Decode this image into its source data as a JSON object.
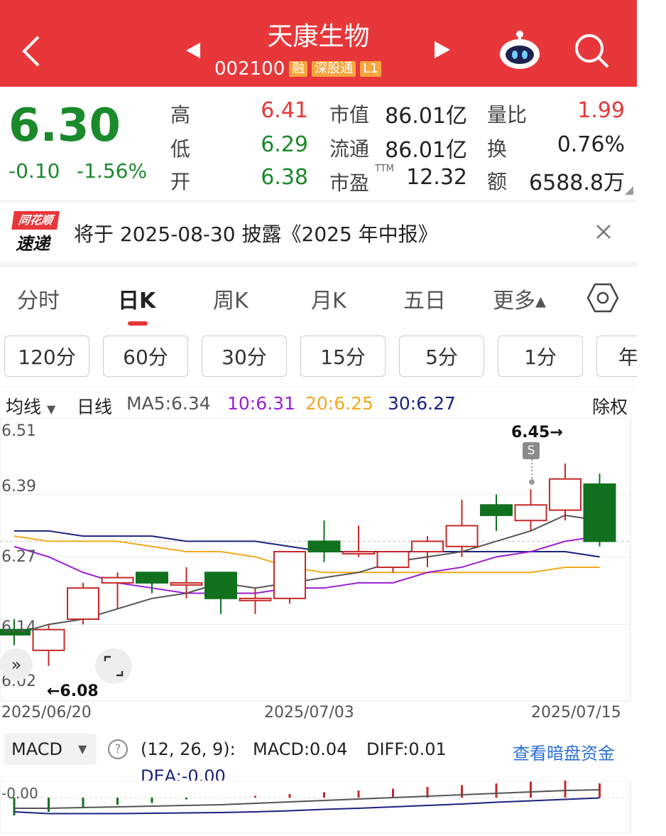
{
  "header": {
    "title": "天康生物",
    "code": "002100",
    "tags": [
      "融",
      "深股通",
      "L1"
    ],
    "back_icon": "chevron-left-icon",
    "prev_icon": "triangle-left-icon",
    "next_icon": "triangle-right-icon",
    "robot_icon": "robot-assistant-icon",
    "search_icon": "search-icon"
  },
  "quote": {
    "price": "6.30",
    "change": "-0.10",
    "change_pct": "-1.56%",
    "high_label": "高",
    "high": "6.41",
    "low_label": "低",
    "low": "6.29",
    "open_label": "开",
    "open": "6.38",
    "mktcap_label": "市值",
    "mktcap": "86.01亿",
    "float_label": "流通",
    "float": "86.01亿",
    "pe_label": "市盈",
    "pe_sup": "TTM",
    "pe": "12.32",
    "vr_label": "量比",
    "vr": "1.99",
    "turnover_label": "换",
    "turnover": "0.76%",
    "amount_label": "额",
    "amount": "6588.8万"
  },
  "news": {
    "logo_top": "同花顺",
    "logo_bottom": "速递",
    "text": "将于 2025-08-30 披露《2025 年中报》"
  },
  "tabs": [
    "分时",
    "日K",
    "周K",
    "月K",
    "五日",
    "更多▴"
  ],
  "active_tab": "日K",
  "periods": [
    "120分",
    "60分",
    "30分",
    "15分",
    "5分",
    "1分",
    "年"
  ],
  "legend": {
    "ma_select": "均线",
    "line_type": "日线",
    "ma5": "MA5:6.34",
    "ma10": "10:6.31",
    "ma20": "20:6.25",
    "ma30": "30:6.27",
    "adjust": "除权"
  },
  "colors": {
    "up": "#c62828",
    "down": "#11711f",
    "ma5": "#555555",
    "ma10": "#9b1fd3",
    "ma20": "#f3a91c",
    "ma30": "#1a237e",
    "accent": "#e8373a"
  },
  "chart_data": {
    "type": "candlestick",
    "y_ticks": [
      "6.51",
      "6.39",
      "6.27",
      "6.14",
      "6.02"
    ],
    "ylim": [
      6.02,
      6.51
    ],
    "date_labels": [
      "2025/06/20",
      "2025/07/03",
      "2025/07/15"
    ],
    "max_label": "6.45→",
    "min_label": "←6.08",
    "marker": "S",
    "candles": [
      {
        "o": 6.13,
        "c": 6.12,
        "h": 6.15,
        "l": 6.1
      },
      {
        "o": 6.09,
        "c": 6.13,
        "h": 6.14,
        "l": 6.06
      },
      {
        "o": 6.15,
        "c": 6.21,
        "h": 6.22,
        "l": 6.14
      },
      {
        "o": 6.22,
        "c": 6.23,
        "h": 6.24,
        "l": 6.17
      },
      {
        "o": 6.24,
        "c": 6.22,
        "h": 6.24,
        "l": 6.2
      },
      {
        "o": 6.22,
        "c": 6.22,
        "h": 6.25,
        "l": 6.19
      },
      {
        "o": 6.24,
        "c": 6.19,
        "h": 6.24,
        "l": 6.16
      },
      {
        "o": 6.19,
        "c": 6.19,
        "h": 6.21,
        "l": 6.16
      },
      {
        "o": 6.19,
        "c": 6.28,
        "h": 6.28,
        "l": 6.18
      },
      {
        "o": 6.3,
        "c": 6.28,
        "h": 6.34,
        "l": 6.26
      },
      {
        "o": 6.28,
        "c": 6.28,
        "h": 6.33,
        "l": 6.27
      },
      {
        "o": 6.25,
        "c": 6.28,
        "h": 6.28,
        "l": 6.24
      },
      {
        "o": 6.28,
        "c": 6.3,
        "h": 6.31,
        "l": 6.25
      },
      {
        "o": 6.29,
        "c": 6.33,
        "h": 6.38,
        "l": 6.27
      },
      {
        "o": 6.37,
        "c": 6.35,
        "h": 6.39,
        "l": 6.32
      },
      {
        "o": 6.34,
        "c": 6.37,
        "h": 6.4,
        "l": 6.32
      },
      {
        "o": 6.36,
        "c": 6.42,
        "h": 6.45,
        "l": 6.34
      },
      {
        "o": 6.41,
        "c": 6.3,
        "h": 6.43,
        "l": 6.29
      }
    ],
    "ma5": [
      6.12,
      6.14,
      6.15,
      6.17,
      6.19,
      6.2,
      6.22,
      6.21,
      6.22,
      6.23,
      6.24,
      6.26,
      6.27,
      6.28,
      6.3,
      6.32,
      6.35,
      6.34
    ],
    "ma10": [
      6.29,
      6.27,
      6.24,
      6.22,
      6.21,
      6.2,
      6.2,
      6.2,
      6.21,
      6.21,
      6.22,
      6.22,
      6.24,
      6.25,
      6.27,
      6.28,
      6.3,
      6.31
    ],
    "ma20": [
      6.31,
      6.3,
      6.3,
      6.3,
      6.29,
      6.28,
      6.28,
      6.27,
      6.25,
      6.24,
      6.24,
      6.24,
      6.24,
      6.24,
      6.24,
      6.24,
      6.25,
      6.25
    ],
    "ma30": [
      6.32,
      6.32,
      6.31,
      6.31,
      6.31,
      6.3,
      6.3,
      6.3,
      6.29,
      6.28,
      6.28,
      6.28,
      6.28,
      6.28,
      6.28,
      6.28,
      6.28,
      6.27
    ]
  },
  "macd": {
    "select": "MACD",
    "params": "(12, 26, 9):",
    "macd": "MACD:0.04",
    "diff": "DIFF:0.01",
    "dea": "DEA:-0.00",
    "link": "查看暗盘资金",
    "zero_label": "-0.00",
    "hist": [
      -0.05,
      -0.04,
      -0.03,
      -0.02,
      -0.015,
      -0.005,
      0.0,
      0.005,
      0.01,
      0.015,
      0.02,
      0.025,
      0.03,
      0.035,
      0.04,
      0.045,
      0.05,
      0.04
    ],
    "dea_line": [
      -0.04,
      -0.045,
      -0.045,
      -0.045,
      -0.044,
      -0.043,
      -0.042,
      -0.04,
      -0.037,
      -0.033,
      -0.03,
      -0.026,
      -0.022,
      -0.018,
      -0.013,
      -0.009,
      -0.005,
      -0.001
    ],
    "diff_line": [
      -0.03,
      -0.03,
      -0.028,
      -0.026,
      -0.024,
      -0.022,
      -0.02,
      -0.016,
      -0.012,
      -0.008,
      -0.004,
      0.0,
      0.004,
      0.008,
      0.012,
      0.016,
      0.02,
      0.022
    ]
  }
}
